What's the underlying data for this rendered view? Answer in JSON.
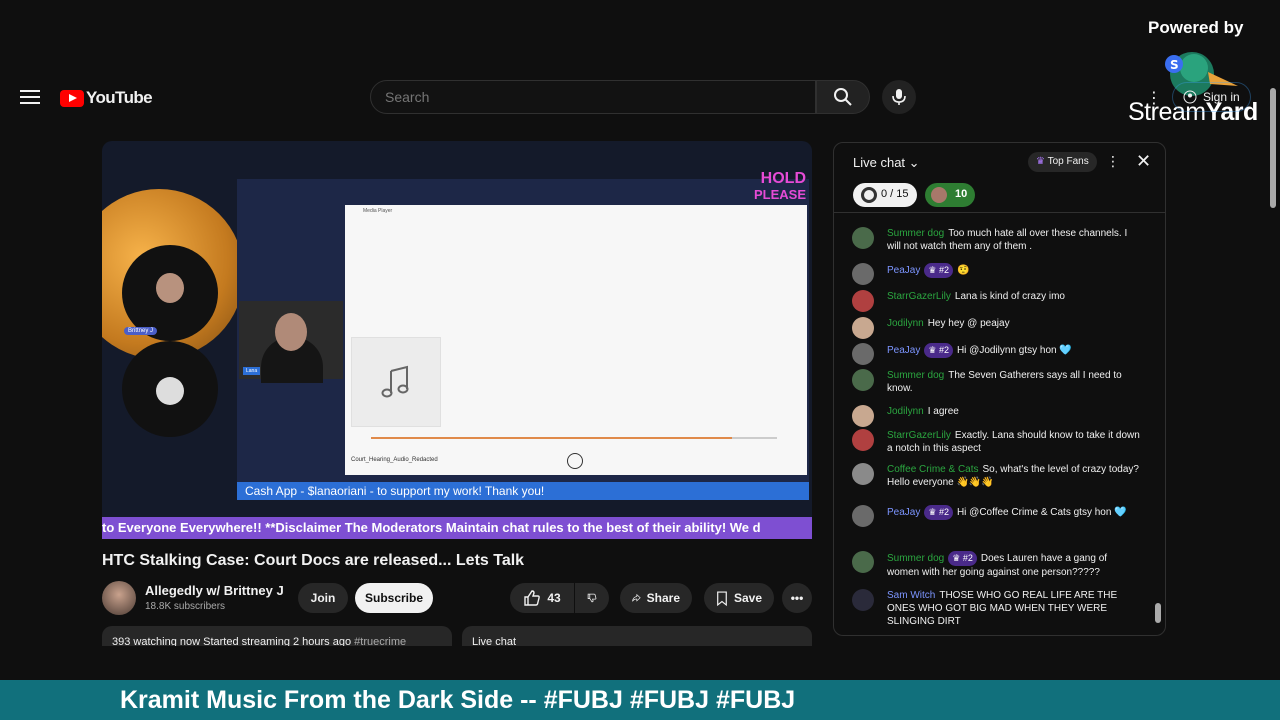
{
  "overlay": {
    "powered_by": "Powered by",
    "brand_light": "Stream",
    "brand_bold": "Yard"
  },
  "header": {
    "logo_text": "YouTube",
    "search_placeholder": "Search",
    "sign_in": "Sign in"
  },
  "video": {
    "hold_line1": "HOLD",
    "hold_line2": "PLEASE",
    "guest_names": [
      "Brittney J",
      "Lana"
    ],
    "player_title": "Media Player",
    "player_file": "Court_Hearing_Audio_Redacted",
    "cash_bar": "Cash App - $lanaoriani - to support my work! Thank you!",
    "ticker": "to Everyone Everywhere!! **Disclaimer The Moderators Maintain chat rules to the best of their ability! We d"
  },
  "meta": {
    "title": "HTC Stalking Case: Court Docs are released... Lets Talk",
    "channel_name": "Allegedly w/ Brittney J",
    "subscribers": "18.8K subscribers",
    "join": "Join",
    "subscribe": "Subscribe",
    "likes": "43",
    "share": "Share",
    "save": "Save",
    "description": "393 watching now  Started streaming 2 hours ago ",
    "description_tag": "#truecrime",
    "live_chat_label": "Live chat"
  },
  "chat": {
    "title": "Live chat",
    "top_fans": "Top Fans",
    "goal_progress": "0 / 15",
    "goal_count": "10",
    "messages": [
      {
        "author": "Summer dog",
        "color": "green",
        "badge": "",
        "text": "Too much hate all over these channels. I will not watch them any of them .",
        "avatar": "#4a6a4a"
      },
      {
        "author": "PeaJay",
        "color": "blue",
        "badge": "#2",
        "text": "🤨",
        "avatar": "#6a6a6a"
      },
      {
        "author": "StarrGazerLily",
        "color": "green",
        "badge": "",
        "text": "Lana is kind of crazy imo",
        "avatar": "#b04040"
      },
      {
        "author": "Jodilynn",
        "color": "green",
        "badge": "",
        "text": "Hey hey @ peajay",
        "avatar": "#c8a890"
      },
      {
        "author": "PeaJay",
        "color": "blue",
        "badge": "#2",
        "text": "Hi @Jodilynn gtsy hon 🩵",
        "avatar": "#6a6a6a"
      },
      {
        "author": "Summer dog",
        "color": "green",
        "badge": "",
        "text": "The Seven Gatherers says all I need to know.",
        "avatar": "#4a6a4a"
      },
      {
        "author": "Jodilynn",
        "color": "green",
        "badge": "",
        "text": "I agree",
        "avatar": "#c8a890"
      },
      {
        "author": "StarrGazerLily",
        "color": "green",
        "badge": "",
        "text": "Exactly. Lana should know to take it down a notch in this aspect",
        "avatar": "#b04040"
      },
      {
        "author": "Coffee Crime & Cats",
        "color": "green",
        "badge": "",
        "text": "So, what's the level of crazy today? Hello everyone 👋👋👋",
        "avatar": "#8a8a8a"
      },
      {
        "author": "PeaJay",
        "color": "blue",
        "badge": "#2",
        "text": "Hi @Coffee Crime & Cats gtsy hon 🩵",
        "avatar": "#6a6a6a"
      },
      {
        "author": "Summer dog",
        "color": "green",
        "badge": "#2",
        "text": "Does Lauren have a gang of women with her going against one person?????",
        "avatar": "#4a6a4a"
      },
      {
        "author": "Sam Witch",
        "color": "blue",
        "badge": "",
        "text": "THOSE WHO GO REAL LIFE ARE THE ONES WHO GOT BIG MAD WHEN THEY WERE SLINGING DIRT",
        "avatar": "#2a2a3a"
      }
    ]
  },
  "banner": {
    "text": "Kramit Music From the Dark Side -- #FUBJ #FUBJ #FUBJ"
  },
  "colors": {
    "accent_red": "#ff0000",
    "banner_teal": "#11707c",
    "ticker_purple": "#7e4fd2",
    "hold_pink": "#e64bd6",
    "cash_blue": "#2c6fd6"
  },
  "icons": [
    "menu-icon",
    "search-icon",
    "mic-icon",
    "user-icon",
    "like-icon",
    "dislike-icon",
    "share-icon",
    "save-icon",
    "more-icon",
    "close-icon",
    "chevron-down-icon",
    "crown-icon",
    "music-note-icon"
  ]
}
